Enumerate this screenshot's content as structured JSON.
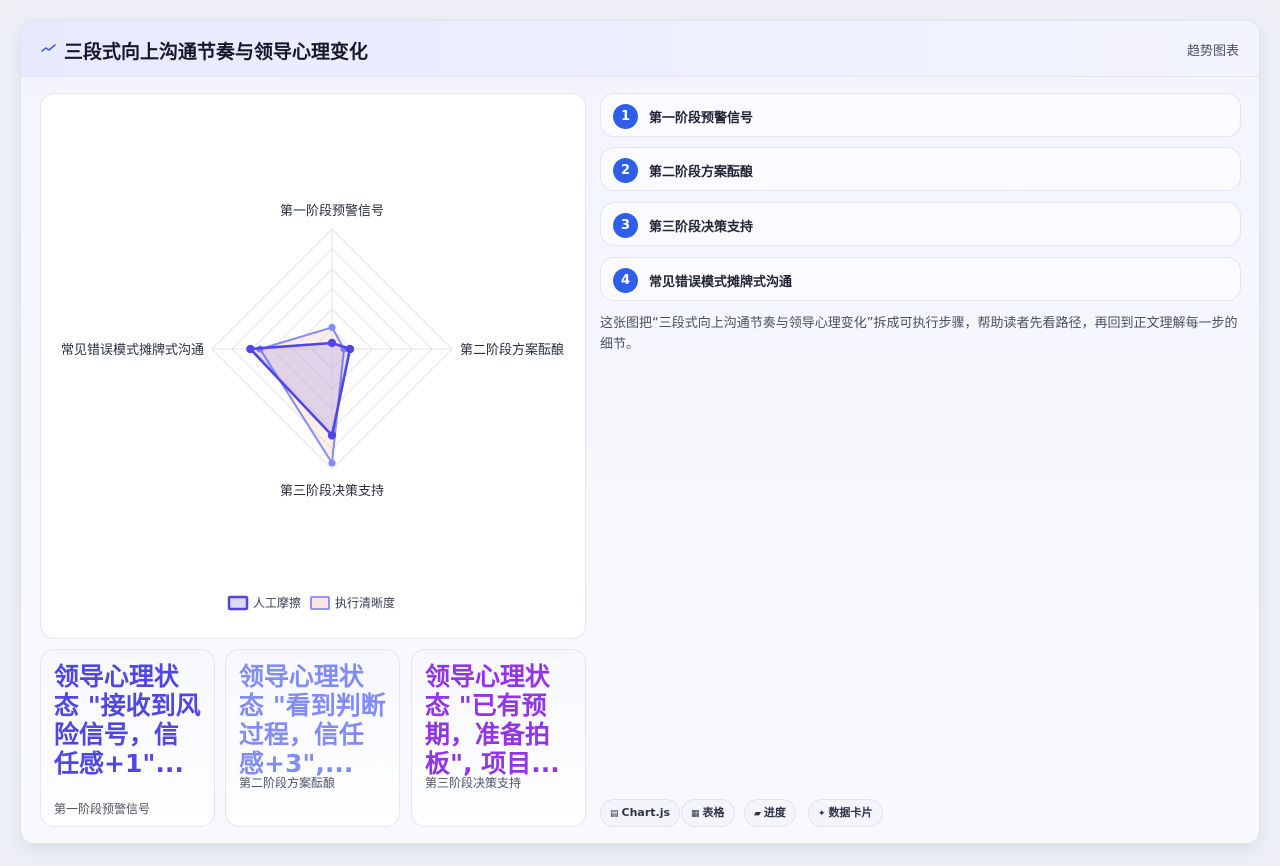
{
  "header": {
    "icon": "trend-line-icon",
    "title": "三段式向上沟通节奏与领导心理变化",
    "tag": "趋势图表"
  },
  "chart_data": {
    "type": "radar",
    "axes": [
      "第一阶段预警信号",
      "第二阶段方案酝酿",
      "第三阶段决策支持",
      "常见错误模式摊牌式沟通"
    ],
    "r_range": [
      0,
      100
    ],
    "grid": true,
    "legend_position": "bottom",
    "series": [
      {
        "name": "人工摩擦",
        "color": "#4f46e5",
        "values": [
          5,
          15,
          72,
          68
        ]
      },
      {
        "name": "执行清晰度",
        "color": "#818cf8",
        "values": [
          18,
          10,
          95,
          60
        ]
      }
    ]
  },
  "stat_cards": [
    {
      "value": "领导心理状态 \"接收到风险信号，信任感+1\"...",
      "label": "第一阶段预警信号",
      "color": "#4f46e5"
    },
    {
      "value": "领导心理状态 \"看到判断过程，信任感+3\",...",
      "label": "第二阶段方案酝酿",
      "color": "#818cf8"
    },
    {
      "value": "领导心理状态 \"已有预期，准备拍板\", 项目...",
      "label": "第三阶段决策支持",
      "color": "#9333ea"
    }
  ],
  "steps": [
    {
      "num": "1",
      "label": "第一阶段预警信号"
    },
    {
      "num": "2",
      "label": "第二阶段方案酝酿"
    },
    {
      "num": "3",
      "label": "第三阶段决策支持"
    },
    {
      "num": "4",
      "label": "常见错误模式摊牌式沟通"
    }
  ],
  "description": "这张图把“三段式向上沟通节奏与领导心理变化”拆成可执行步骤，帮助读者先看路径，再回到正文理解每一步的细节。",
  "chips": [
    {
      "icon": "chart-icon",
      "glyph": "▤",
      "label": "Chart.js"
    },
    {
      "icon": "table-icon",
      "glyph": "▦",
      "label": "表格"
    },
    {
      "icon": "progress-icon",
      "glyph": "▰",
      "label": "进度"
    },
    {
      "icon": "sparkle-icon",
      "glyph": "✦",
      "label": "数据卡片"
    }
  ]
}
